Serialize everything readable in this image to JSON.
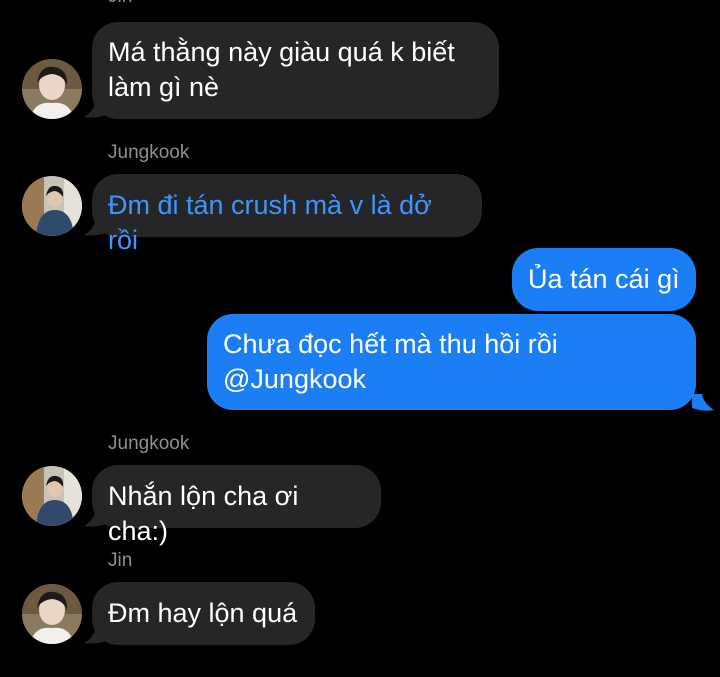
{
  "colors": {
    "background": "#000000",
    "incoming_bubble": "#262628",
    "outgoing_bubble": "#1b7ef5",
    "sender_name": "#8e8e93",
    "link_text": "#3b97ff"
  },
  "messages": [
    {
      "sender": "Jin",
      "text": "Má thằng này giàu quá k biết\nlàm gì nè",
      "direction": "incoming",
      "avatar": "jin-avatar"
    },
    {
      "sender": "Jungkook",
      "text": "Đm đi tán crush mà v là dở rồi",
      "direction": "incoming",
      "avatar": "jungkook-avatar"
    },
    {
      "text": "Ủa tán cái gì",
      "direction": "outgoing"
    },
    {
      "text": "Chưa đọc hết mà thu hồi rồi\n@Jungkook",
      "direction": "outgoing"
    },
    {
      "sender": "Jungkook",
      "text": "Nhắn lộn cha ơi cha:)",
      "direction": "incoming",
      "avatar": "jungkook-avatar"
    },
    {
      "sender": "Jin",
      "text": "Đm hay lộn quá",
      "direction": "incoming",
      "avatar": "jin-avatar"
    }
  ]
}
